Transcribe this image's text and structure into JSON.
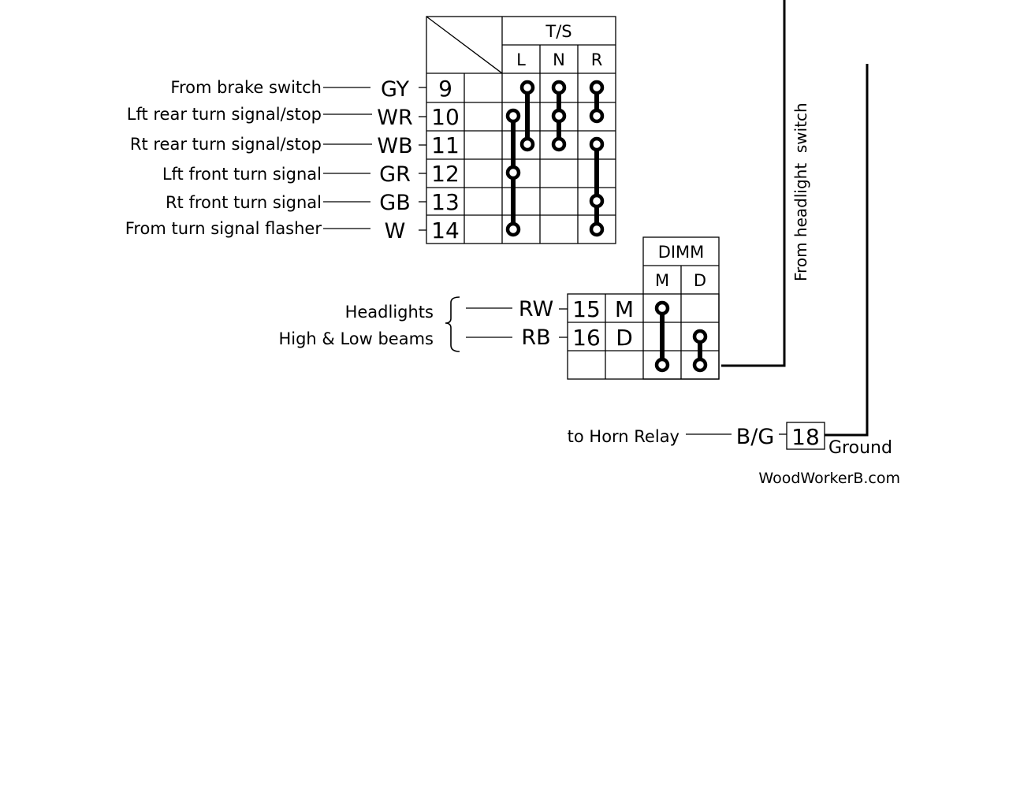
{
  "turn_signal_table": {
    "header": "T/S",
    "columns": [
      "L",
      "N",
      "R"
    ],
    "rows": [
      {
        "label": "From brake switch",
        "wire": "GY",
        "pin": "9"
      },
      {
        "label": "Lft rear turn signal/stop",
        "wire": "WR",
        "pin": "10"
      },
      {
        "label": "Rt rear turn signal/stop",
        "wire": "WB",
        "pin": "11"
      },
      {
        "label": "Lft front turn signal",
        "wire": "GR",
        "pin": "12"
      },
      {
        "label": "Rt front turn signal",
        "wire": "GB",
        "pin": "13"
      },
      {
        "label": "From turn signal flasher",
        "wire": "W",
        "pin": "14"
      }
    ],
    "connections": [
      {
        "column": "L",
        "pins": [
          "10",
          "12",
          "14"
        ]
      },
      {
        "column": "L",
        "pins": [
          "9",
          "11"
        ]
      },
      {
        "column": "N",
        "pins": [
          "9",
          "10",
          "11"
        ]
      },
      {
        "column": "R",
        "pins": [
          "9",
          "10"
        ]
      },
      {
        "column": "R",
        "pins": [
          "11",
          "13",
          "14"
        ]
      }
    ]
  },
  "dimmer_table": {
    "header": "DIMM",
    "columns": [
      "M",
      "D"
    ],
    "group_labels": [
      "Headlights",
      "High & Low beams"
    ],
    "rows": [
      {
        "wire": "RW",
        "pin": "15",
        "pos": "M"
      },
      {
        "wire": "RB",
        "pin": "16",
        "pos": "D"
      },
      {
        "wire": "",
        "pin": "",
        "pos": ""
      }
    ],
    "connections": [
      {
        "column": "M",
        "rows": [
          "15",
          "input"
        ]
      },
      {
        "column": "D",
        "rows": [
          "16",
          "input"
        ]
      }
    ]
  },
  "headlight_feed_label": "From headlight  switch",
  "horn": {
    "label": "to Horn Relay",
    "wire": "B/G",
    "pin": "18",
    "ground_label": "Ground"
  },
  "credit": "WoodWorkerB.com"
}
